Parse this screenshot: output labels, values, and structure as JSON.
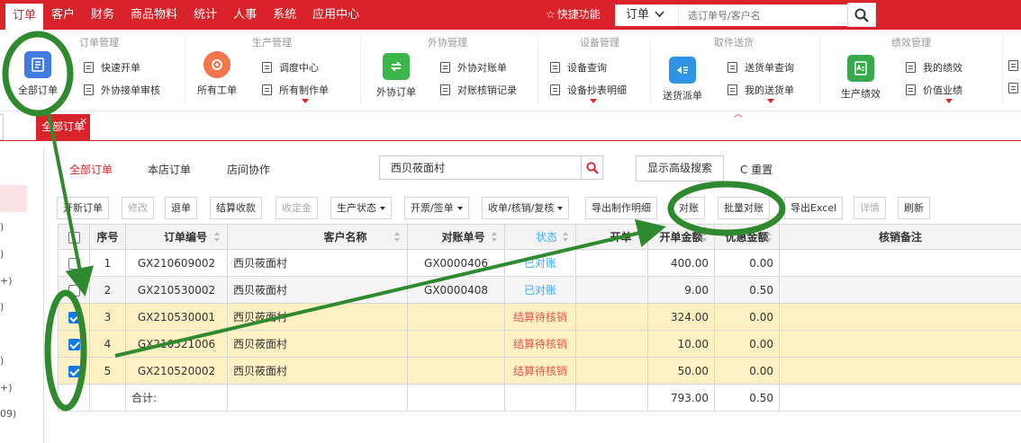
{
  "topnav": {
    "menu": [
      "订单",
      "客户",
      "财务",
      "商品物料",
      "统计",
      "人事",
      "系统",
      "应用中心"
    ],
    "quick": "快捷功能",
    "search_type": "订单",
    "search_placeholder": "选订单号/客户名"
  },
  "ribbon": {
    "groups": [
      "订单管理",
      "生产管理",
      "外协管理",
      "设备管理",
      "取件送货",
      "绩效管理"
    ],
    "big": [
      "全部订单",
      "所有工单",
      "外协订单",
      "送货派单",
      "生产绩效"
    ],
    "small": [
      "快速开单",
      "外协接单审核",
      "调度中心",
      "所有制作单",
      "外协对账单",
      "对账核销记录",
      "设备查询",
      "设备抄表明细",
      "送货单查询",
      "我的送货单",
      "我的绩效",
      "价值业绩"
    ]
  },
  "tabs": {
    "active": "全部订单",
    "close": "×"
  },
  "sidebar": {
    "items": [
      ")",
      ")",
      "+)",
      ")",
      ")",
      "+)",
      "09)"
    ]
  },
  "subtabs": [
    "全部订单",
    "本店订单",
    "店间协作"
  ],
  "filter": {
    "value": "西贝莜面村",
    "advanced": "显示高级搜索",
    "reset": "重置"
  },
  "toolbar": {
    "buttons": [
      "开新订单",
      "修改",
      "退单",
      "结算收款",
      "收定金",
      "生产状态",
      "开票/签单",
      "收单/核销/复核",
      "导出制作明细",
      "对账",
      "批量对账",
      "导出Excel",
      "详情",
      "刷新"
    ]
  },
  "table": {
    "columns": [
      "序号",
      "订单编号",
      "客户名称",
      "对账单号",
      "状态",
      "开单",
      "开单金额",
      "优惠金额",
      "核销备注"
    ],
    "rows": [
      {
        "idx": "1",
        "order": "GX210609002",
        "customer": "西贝莜面村",
        "bill": "GX0000406",
        "status": "已对账",
        "amount": "400.00",
        "discount": "0.00",
        "checked": false
      },
      {
        "idx": "2",
        "order": "GX210530002",
        "customer": "西贝莜面村",
        "bill": "GX0000408",
        "status": "已对账",
        "amount": "9.00",
        "discount": "0.50",
        "checked": false
      },
      {
        "idx": "3",
        "order": "GX210530001",
        "customer": "西贝莜面村",
        "bill": "",
        "status": "结算待核销",
        "amount": "324.00",
        "discount": "0.00",
        "checked": true
      },
      {
        "idx": "4",
        "order": "GX210521006",
        "customer": "西贝莜面村",
        "bill": "",
        "status": "结算待核销",
        "amount": "10.00",
        "discount": "0.00",
        "checked": true
      },
      {
        "idx": "5",
        "order": "GX210520002",
        "customer": "西贝莜面村",
        "bill": "",
        "status": "结算待核销",
        "amount": "50.00",
        "discount": "0.00",
        "checked": true
      }
    ],
    "total_label": "合计:",
    "total_amount": "793.00",
    "total_discount": "0.50"
  },
  "colors": {
    "brand": "#d9222a",
    "annotation": "#2f8a2f",
    "selected_row": "#fdf1c4"
  }
}
